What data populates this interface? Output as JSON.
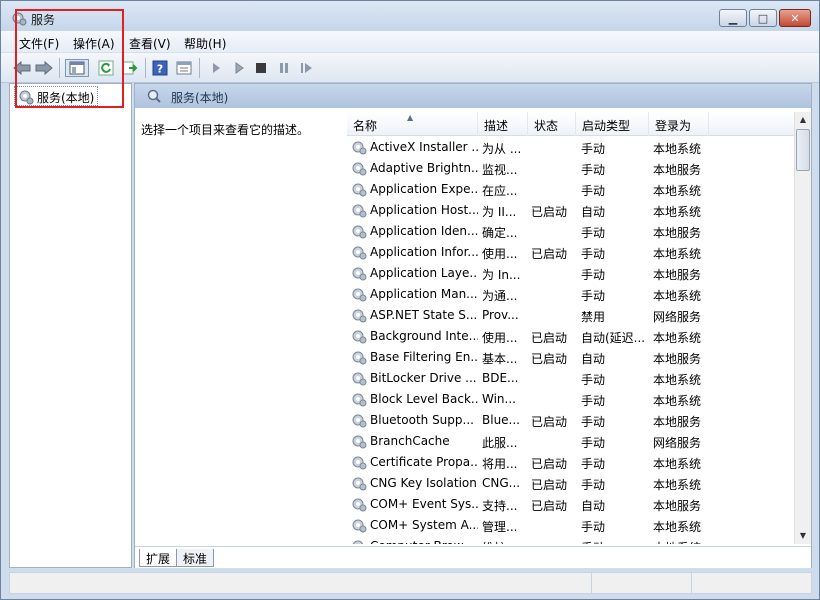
{
  "window": {
    "title": "服务"
  },
  "menu": [
    "文件(F)",
    "操作(A)",
    "查看(V)",
    "帮助(H)"
  ],
  "toolbar": [
    "back-icon",
    "forward-icon",
    "show-tree-icon",
    "refresh-icon",
    "export-icon",
    "help-icon",
    "properties-icon",
    "start-icon",
    "start-alt-icon",
    "stop-icon",
    "pause-icon",
    "restart-icon"
  ],
  "tree": {
    "root": "服务(本地)"
  },
  "pane": {
    "header": "服务(本地)",
    "description_hint": "选择一个项目来查看它的描述。"
  },
  "columns": [
    "名称",
    "描述",
    "状态",
    "启动类型",
    "登录为"
  ],
  "services": [
    {
      "name": "ActiveX Installer ...",
      "desc": "为从 ...",
      "status": "",
      "startup": "手动",
      "logon": "本地系统"
    },
    {
      "name": "Adaptive Brightn...",
      "desc": "监视...",
      "status": "",
      "startup": "手动",
      "logon": "本地服务"
    },
    {
      "name": "Application Expe...",
      "desc": "在应...",
      "status": "",
      "startup": "手动",
      "logon": "本地系统"
    },
    {
      "name": "Application Host...",
      "desc": "为 II...",
      "status": "已启动",
      "startup": "自动",
      "logon": "本地系统"
    },
    {
      "name": "Application Iden...",
      "desc": "确定...",
      "status": "",
      "startup": "手动",
      "logon": "本地服务"
    },
    {
      "name": "Application Infor...",
      "desc": "使用...",
      "status": "已启动",
      "startup": "手动",
      "logon": "本地系统"
    },
    {
      "name": "Application Laye...",
      "desc": "为 In...",
      "status": "",
      "startup": "手动",
      "logon": "本地服务"
    },
    {
      "name": "Application Man...",
      "desc": "为通...",
      "status": "",
      "startup": "手动",
      "logon": "本地系统"
    },
    {
      "name": "ASP.NET State S...",
      "desc": "Prov...",
      "status": "",
      "startup": "禁用",
      "logon": "网络服务"
    },
    {
      "name": "Background Inte...",
      "desc": "使用...",
      "status": "已启动",
      "startup": "自动(延迟...",
      "logon": "本地系统"
    },
    {
      "name": "Base Filtering En...",
      "desc": "基本...",
      "status": "已启动",
      "startup": "自动",
      "logon": "本地服务"
    },
    {
      "name": "BitLocker Drive ...",
      "desc": "BDE...",
      "status": "",
      "startup": "手动",
      "logon": "本地系统"
    },
    {
      "name": "Block Level Back...",
      "desc": "Win...",
      "status": "",
      "startup": "手动",
      "logon": "本地系统"
    },
    {
      "name": "Bluetooth Supp...",
      "desc": "Blue...",
      "status": "已启动",
      "startup": "手动",
      "logon": "本地服务"
    },
    {
      "name": "BranchCache",
      "desc": "此服...",
      "status": "",
      "startup": "手动",
      "logon": "网络服务"
    },
    {
      "name": "Certificate Propa...",
      "desc": "将用...",
      "status": "已启动",
      "startup": "手动",
      "logon": "本地系统"
    },
    {
      "name": "CNG Key Isolation",
      "desc": "CNG...",
      "status": "已启动",
      "startup": "手动",
      "logon": "本地系统"
    },
    {
      "name": "COM+ Event Sys...",
      "desc": "支持...",
      "status": "已启动",
      "startup": "自动",
      "logon": "本地服务"
    },
    {
      "name": "COM+ System A...",
      "desc": "管理...",
      "status": "",
      "startup": "手动",
      "logon": "本地系统"
    },
    {
      "name": "Computer Brow...",
      "desc": "维护...",
      "status": "",
      "startup": "手动",
      "logon": "本地系统"
    }
  ],
  "tabs": [
    "扩展",
    "标准"
  ],
  "colors": {
    "annotation": "#e02020",
    "header": "#aec3dd"
  }
}
